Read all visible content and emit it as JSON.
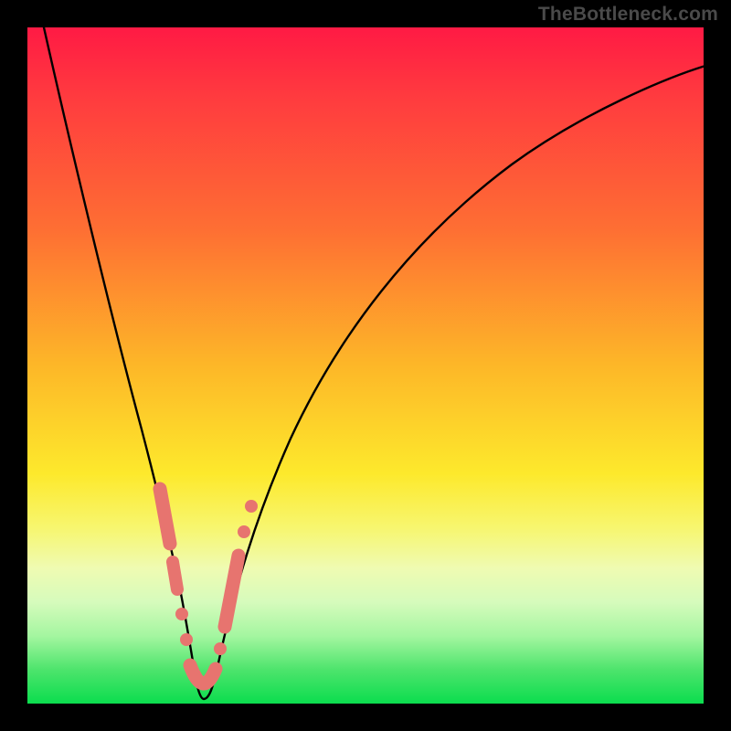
{
  "watermark": "TheBottleneck.com",
  "colors": {
    "background": "#000000",
    "gradient_top": "#ff1a44",
    "gradient_mid1": "#fdb728",
    "gradient_mid2": "#fde92c",
    "gradient_bottom": "#0bdd4e",
    "curve": "#000000",
    "markers": "#e7746f"
  },
  "chart_data": {
    "type": "line",
    "title": "",
    "xlabel": "",
    "ylabel": "",
    "xlim": [
      0,
      100
    ],
    "ylim": [
      0,
      100
    ],
    "series": [
      {
        "name": "bottleneck-curve",
        "x": [
          2,
          4,
          6,
          8,
          10,
          12,
          14,
          16,
          18,
          19,
          20,
          21,
          22,
          23,
          24,
          25,
          26,
          27,
          28,
          30,
          32,
          34,
          38,
          42,
          48,
          56,
          66,
          78,
          90,
          100
        ],
        "y": [
          100,
          92,
          84,
          76,
          68,
          60,
          52,
          43,
          33,
          27,
          21,
          15,
          9,
          4,
          1,
          1,
          4,
          10,
          17,
          28,
          37,
          44,
          55,
          63,
          72,
          79,
          85,
          89,
          92,
          94
        ]
      }
    ],
    "markers": [
      {
        "x_range": [
          18.0,
          19.5
        ],
        "y_range": [
          32,
          23
        ],
        "shape": "capsule"
      },
      {
        "x_range": [
          20.2,
          20.8
        ],
        "y_range": [
          19,
          15
        ],
        "shape": "capsule"
      },
      {
        "x": 21.4,
        "y": 12,
        "shape": "dot"
      },
      {
        "x": 22.0,
        "y": 8,
        "shape": "dot"
      },
      {
        "x_range": [
          22.6,
          25.8
        ],
        "y_range": [
          4,
          2
        ],
        "shape": "capsule"
      },
      {
        "x": 26.6,
        "y": 6,
        "shape": "dot"
      },
      {
        "x_range": [
          27.4,
          29.4
        ],
        "y_range": [
          12,
          24
        ],
        "shape": "capsule"
      },
      {
        "x": 30.4,
        "y": 30,
        "shape": "dot"
      },
      {
        "x": 31.4,
        "y": 34,
        "shape": "dot"
      }
    ]
  }
}
